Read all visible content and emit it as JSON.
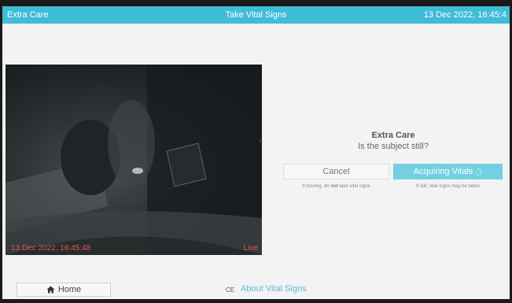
{
  "titlebar": {
    "app_name": "Extra Care",
    "screen_title": "Take Vital Signs",
    "datetime": "13 Dec 2022, 16:45:4"
  },
  "video": {
    "timestamp": "13 Dec 2022, 16:45:48",
    "status": "Live"
  },
  "panel": {
    "title": "Extra Care",
    "question": "Is the subject still?",
    "cancel_label": "Cancel",
    "acquire_label": "Acquiring Vitals",
    "hint_left_prefix": "If moving, do ",
    "hint_left_bold": "not",
    "hint_left_suffix": " take vital signs",
    "hint_right": "If still, vital signs may be taken"
  },
  "footer": {
    "home_label": "Home",
    "ce_mark": "CE",
    "about_label": "About Vital Signs"
  },
  "colors": {
    "titlebar": "#3fbcd8",
    "accent_button": "#74cfe2",
    "video_text": "#e25555",
    "link": "#5fb9d6"
  }
}
